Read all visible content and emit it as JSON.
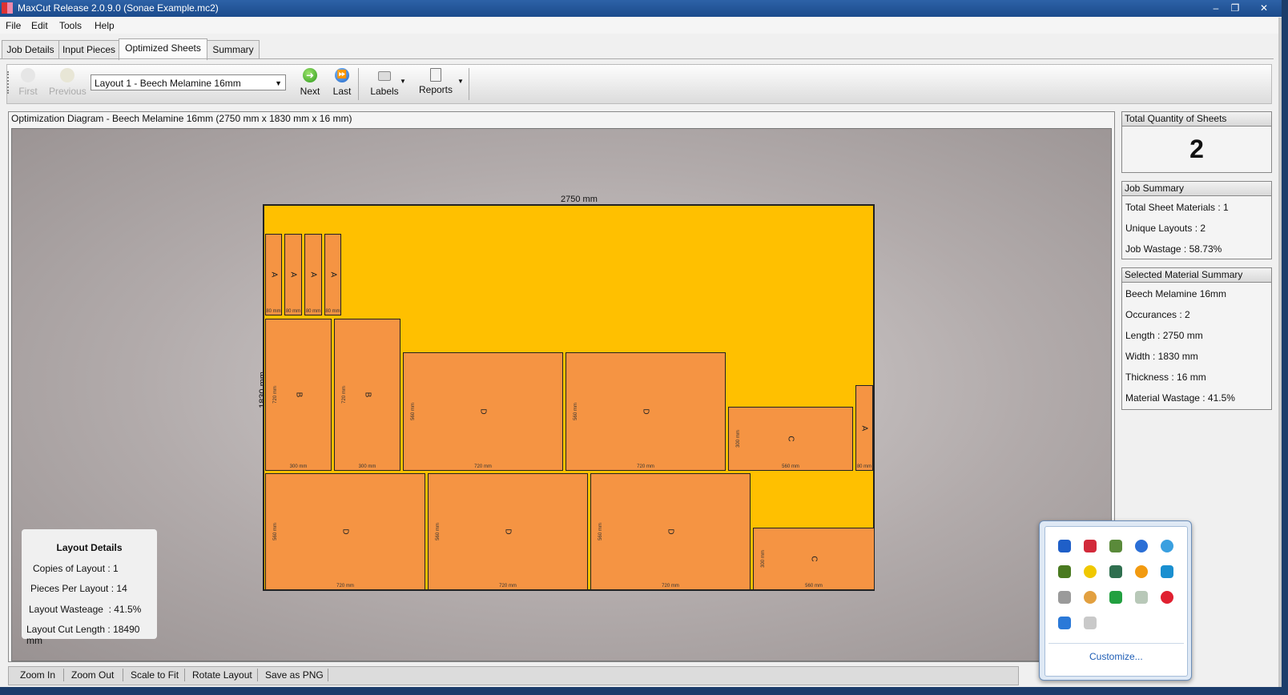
{
  "window": {
    "title": "MaxCut Release 2.0.9.0 (Sonae Example.mc2)"
  },
  "menu": [
    "File",
    "Edit",
    "Tools",
    "Help"
  ],
  "tabs": [
    "Job Details",
    "Input Pieces",
    "Optimized Sheets",
    "Summary"
  ],
  "toolbar": {
    "first": "First",
    "previous": "Previous",
    "layout_select": "Layout 1 - Beech Melamine 16mm",
    "next": "Next",
    "last": "Last",
    "labels": "Labels",
    "reports": "Reports"
  },
  "diagram": {
    "header": "Optimization Diagram - Beech Melamine 16mm (2750 mm x 1830 mm x 16 mm)",
    "sheet_width_label": "2750 mm",
    "sheet_height_label": "1830 mm",
    "pieces": [
      {
        "label": "A",
        "w": "80 mm",
        "h": ""
      },
      {
        "label": "A",
        "w": "80 mm",
        "h": ""
      },
      {
        "label": "A",
        "w": "80 mm",
        "h": ""
      },
      {
        "label": "A",
        "w": "80 mm",
        "h": ""
      },
      {
        "label": "B",
        "w": "300 mm",
        "h": "720 mm"
      },
      {
        "label": "B",
        "w": "300 mm",
        "h": "720 mm"
      },
      {
        "label": "D",
        "w": "720 mm",
        "h": "560 mm"
      },
      {
        "label": "D",
        "w": "720 mm",
        "h": "560 mm"
      },
      {
        "label": "C",
        "w": "560 mm",
        "h": "300 mm"
      },
      {
        "label": "A",
        "w": "80 mm",
        "h": ""
      },
      {
        "label": "D",
        "w": "720 mm",
        "h": "560 mm"
      },
      {
        "label": "D",
        "w": "720 mm",
        "h": "560 mm"
      },
      {
        "label": "D",
        "w": "720 mm",
        "h": "560 mm"
      },
      {
        "label": "C",
        "w": "560 mm",
        "h": "300 mm"
      }
    ]
  },
  "layout_details": {
    "title": "Layout Details",
    "copies": "Copies of Layout : 1",
    "pieces": "Pieces Per Layout : 14",
    "wastage": "Layout Wasteage  : 41.5%",
    "cut_length": "Layout Cut Length : 18490 mm"
  },
  "bottom_buttons": [
    "Zoom In",
    "Zoom Out",
    "Scale to Fit",
    "Rotate Layout",
    "Save as PNG"
  ],
  "total_quantity": {
    "title": "Total Quantity of Sheets",
    "value": "2"
  },
  "job_summary": {
    "title": "Job Summary",
    "rows": [
      "Total Sheet Materials : 1",
      "Unique Layouts : 2",
      "Job Wastage : 58.73%"
    ]
  },
  "material_summary": {
    "title": "Selected Material Summary",
    "rows": [
      "Beech Melamine 16mm",
      "Occurances : 2",
      "Length : 2750 mm",
      "Width : 1830 mm",
      "Thickness : 16 mm",
      "Material Wastage : 41.5%"
    ]
  },
  "tray": {
    "customize": "Customize...",
    "icons": [
      "bluetooth-icon",
      "security-icon",
      "power-icon",
      "lightning-icon",
      "network-icon",
      "arrows-icon",
      "chat-icon",
      "audio-icon",
      "update-icon",
      "display-icon",
      "printer-icon",
      "blocked-icon",
      "sync-icon",
      "check-icon",
      "record-icon",
      "globe-icon",
      "mouse-icon"
    ]
  },
  "colors": {
    "sheet": "#ffc000",
    "piece": "#f59443",
    "title_bar": "#2d62a7"
  }
}
